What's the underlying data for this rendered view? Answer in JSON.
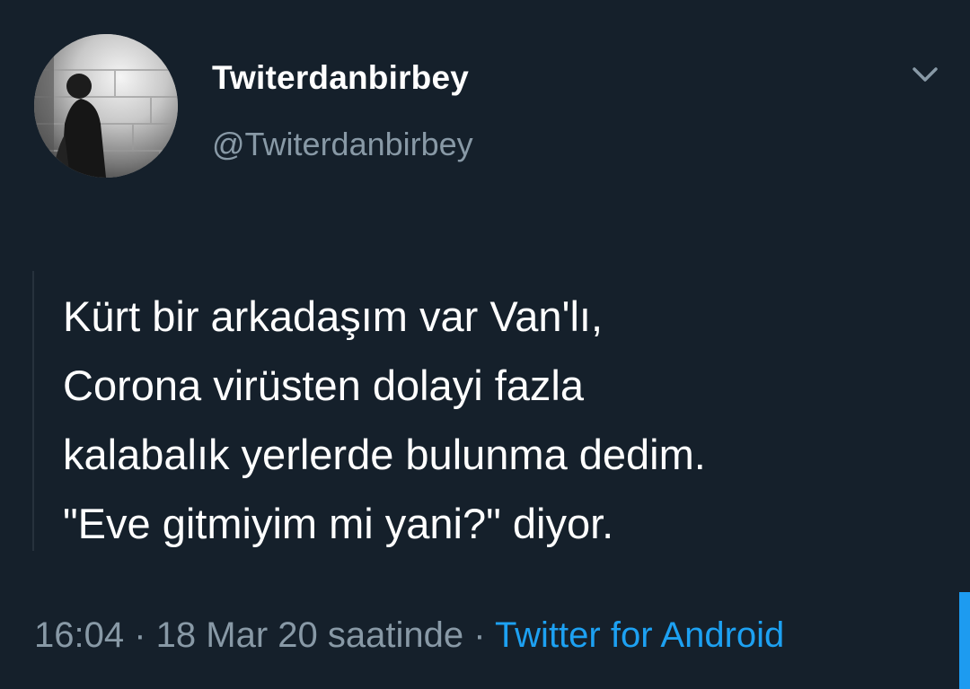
{
  "user": {
    "display_name": "Twiterdanbirbey",
    "handle": "@Twiterdanbirbey",
    "avatar_icon": "profile-photo"
  },
  "menu_icon": "chevron-down-icon",
  "tweet": {
    "lines": [
      "Kürt bir arkadaşım var Van'lı,",
      "Corona virüsten dolayi fazla",
      "kalabalık yerlerde bulunma dedim.",
      "\"Eve gitmiyim mi yani?\" diyor."
    ]
  },
  "meta": {
    "time": "16:04",
    "separator": " · ",
    "date_text": "18 Mar 20 saatinde",
    "separator2": " · ",
    "source": "Twitter for Android"
  },
  "colors": {
    "background": "#15202b",
    "secondary_text": "#8899a6",
    "link": "#1da1f2"
  }
}
